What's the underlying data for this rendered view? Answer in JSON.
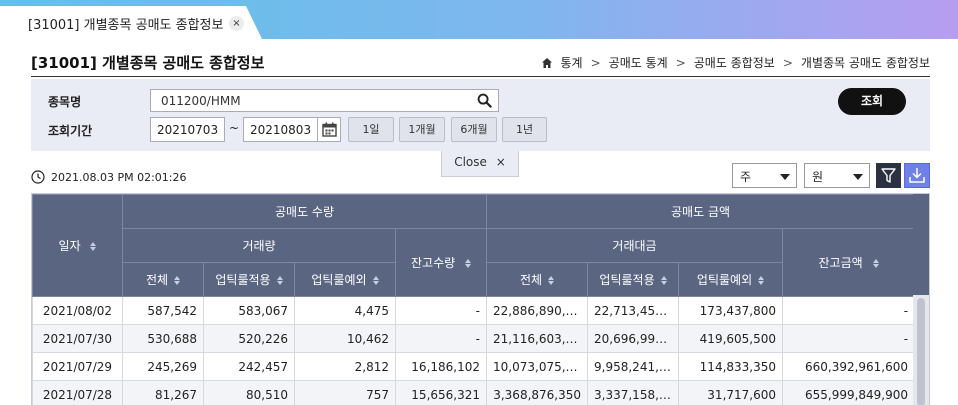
{
  "tab": {
    "title": "[31001] 개별종목 공매도 종합정보",
    "close": "×"
  },
  "header": {
    "title": "[31001] 개별종목 공매도 종합정보",
    "breadcrumb": [
      "통계",
      "공매도 통계",
      "공매도 종합정보",
      "개별종목 공매도 종합정보"
    ],
    "separator": ">"
  },
  "search": {
    "stock_label": "종목명",
    "stock_value": "011200/HMM",
    "period_label": "조회기간",
    "date_from": "20210703",
    "tilde": "~",
    "date_to": "20210803",
    "periods": [
      "1일",
      "1개월",
      "6개월",
      "1년"
    ],
    "query_button": "조회",
    "close_label": "Close",
    "close_x": "×"
  },
  "toolbar": {
    "timestamp": "2021.08.03 PM 02:01:26",
    "unit_period": "주",
    "unit_currency": "원"
  },
  "table": {
    "headers": {
      "date": "일자",
      "volume_group": "공매도 수량",
      "amount_group": "공매도 금액",
      "trade_volume": "거래량",
      "balance_volume": "잔고수량",
      "trade_amount": "거래대금",
      "balance_amount": "잔고금액",
      "total": "전체",
      "uptick_applied": "업틱룰적용",
      "uptick_exempt": "업틱룰예외"
    },
    "rows": [
      [
        "2021/08/02",
        "587,542",
        "583,067",
        "4,475",
        "-",
        "22,886,890,7...",
        "22,713,452,...",
        "173,437,800",
        "-"
      ],
      [
        "2021/07/30",
        "530,688",
        "520,226",
        "10,462",
        "-",
        "21,116,603,0...",
        "20,696,997,...",
        "419,605,500",
        "-"
      ],
      [
        "2021/07/29",
        "245,269",
        "242,457",
        "2,812",
        "16,186,102",
        "10,073,075,1...",
        "9,958,241,8...",
        "114,833,350",
        "660,392,961,600"
      ],
      [
        "2021/07/28",
        "81,267",
        "80,510",
        "757",
        "15,656,321",
        "3,368,876,350",
        "3,337,158,7...",
        "31,717,600",
        "655,999,849,900"
      ]
    ]
  },
  "colors": {
    "header_bg": "#5a6582",
    "panel_bg": "#e9ebf5",
    "accent_button": "#6f80e8"
  }
}
